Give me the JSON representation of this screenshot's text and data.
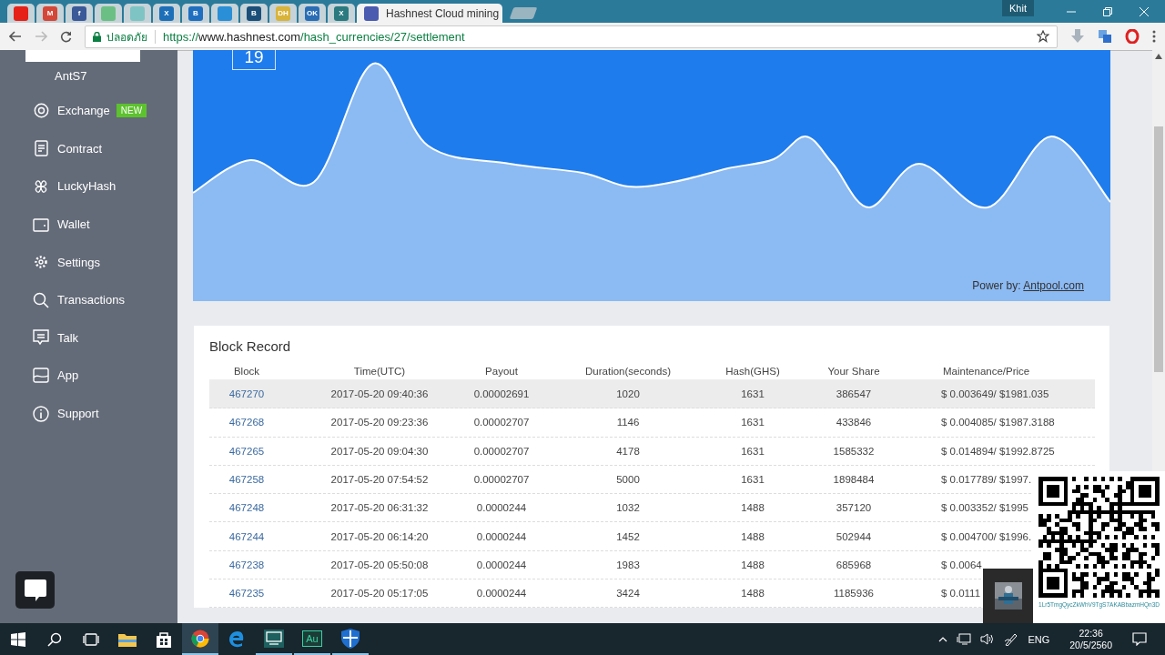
{
  "browser": {
    "tabs": [
      {
        "color": "#e62117",
        "selected": false
      },
      {
        "glyph": "M",
        "color": "#d44638",
        "selected": false
      },
      {
        "glyph": "f",
        "color": "#3b5998",
        "selected": false
      },
      {
        "color": "#6cbf84",
        "selected": false
      },
      {
        "color": "#7fc4c4",
        "selected": false
      },
      {
        "glyph": "X",
        "color": "#1d6fb8",
        "selected": false
      },
      {
        "glyph": "B",
        "color": "#1e6fc0",
        "selected": false
      },
      {
        "color": "#2a8fd6",
        "selected": false
      },
      {
        "glyph": "B",
        "color": "#1b4f7a",
        "selected": false
      },
      {
        "glyph": "DH",
        "color": "#d9b43a",
        "selected": false
      },
      {
        "glyph": "OK",
        "color": "#2a6db5",
        "selected": false
      },
      {
        "glyph": "X",
        "color": "#2a7a80",
        "selected": false
      },
      {
        "title": "Hashnest Cloud mining",
        "color": "#4b5bb0",
        "selected": true
      }
    ],
    "profile": "Khit",
    "security_label": "ปลอดภัย",
    "url": {
      "scheme": "https://",
      "host": "www.hashnest.com",
      "path": "/hash_currencies/27/settlement"
    }
  },
  "sidebar": {
    "items": [
      {
        "label": "AntS7",
        "kind": "subitem"
      },
      {
        "label": "Exchange",
        "kind": "item",
        "badge": "NEW"
      },
      {
        "label": "Contract",
        "kind": "item"
      },
      {
        "label": "LuckyHash",
        "kind": "item"
      },
      {
        "label": "Wallet",
        "kind": "item"
      },
      {
        "label": "Settings",
        "kind": "item"
      },
      {
        "label": "Transactions",
        "kind": "item"
      },
      {
        "label": "Talk",
        "kind": "item"
      },
      {
        "label": "App",
        "kind": "item"
      },
      {
        "label": "Support",
        "kind": "item"
      }
    ]
  },
  "chart_card": {
    "counter": "19",
    "credit_label": "Power by:",
    "credit_link": "Antpool.com"
  },
  "block_record": {
    "title": "Block Record",
    "columns": [
      "Block",
      "Time(UTC)",
      "Payout",
      "Duration(seconds)",
      "Hash(GHS)",
      "Your Share",
      "Maintenance/Price"
    ],
    "rows": [
      {
        "selected": true,
        "cells": [
          "467270",
          "2017-05-20 09:40:36",
          "0.00002691",
          "1020",
          "1631",
          "386547",
          "$ 0.003649/ $1981.035"
        ]
      },
      {
        "selected": false,
        "cells": [
          "467268",
          "2017-05-20 09:23:36",
          "0.00002707",
          "1146",
          "1631",
          "433846",
          "$ 0.004085/ $1987.3188"
        ]
      },
      {
        "selected": false,
        "cells": [
          "467265",
          "2017-05-20 09:04:30",
          "0.00002707",
          "4178",
          "1631",
          "1585332",
          "$ 0.014894/ $1992.8725"
        ]
      },
      {
        "selected": false,
        "cells": [
          "467258",
          "2017-05-20 07:54:52",
          "0.00002707",
          "5000",
          "1631",
          "1898484",
          "$ 0.017789/ $1997."
        ]
      },
      {
        "selected": false,
        "cells": [
          "467248",
          "2017-05-20 06:31:32",
          "0.0000244",
          "1032",
          "1488",
          "357120",
          "$ 0.003352/ $1995"
        ]
      },
      {
        "selected": false,
        "cells": [
          "467244",
          "2017-05-20 06:14:20",
          "0.0000244",
          "1452",
          "1488",
          "502944",
          "$ 0.004700/ $1996."
        ]
      },
      {
        "selected": false,
        "cells": [
          "467238",
          "2017-05-20 05:50:08",
          "0.0000244",
          "1983",
          "1488",
          "685968",
          "$ 0.0064"
        ]
      },
      {
        "selected": false,
        "cells": [
          "467235",
          "2017-05-20 05:17:05",
          "0.0000244",
          "3424",
          "1488",
          "1185936",
          "$ 0.0111"
        ]
      }
    ]
  },
  "qr_overlay": {
    "address": "1Lr5TmgQycZkWhV9TgS7AKABbazmHQn3D"
  },
  "taskbar": {
    "app_label": "Au",
    "language": "ENG",
    "time": "22:36",
    "date": "20/5/2560"
  }
}
